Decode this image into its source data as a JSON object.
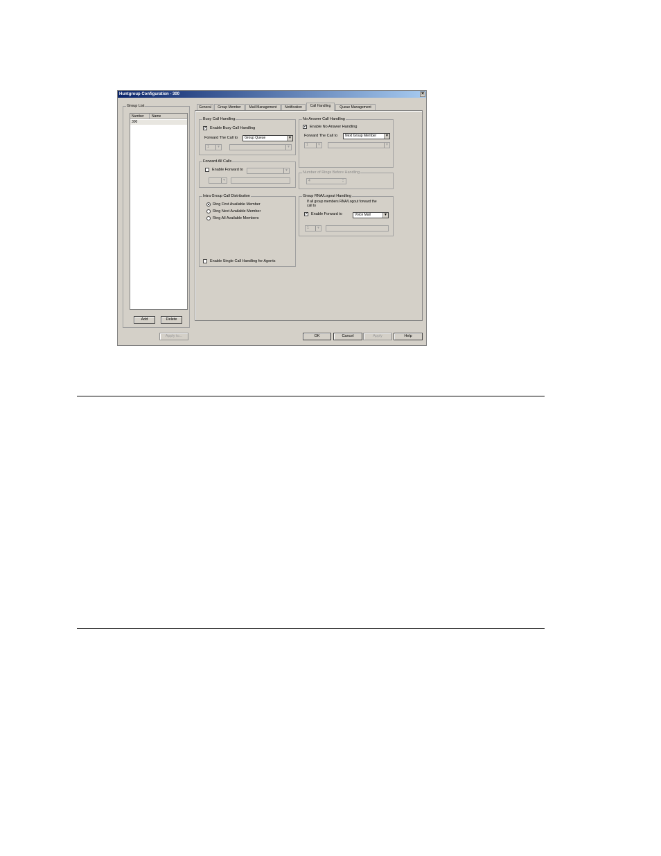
{
  "window": {
    "title": "Huntgroup Configuration - 300",
    "close_glyph": "×"
  },
  "group_list": {
    "title": "Group List",
    "columns": [
      "Number",
      "Name"
    ],
    "rows": [
      {
        "number": "300",
        "name": ""
      }
    ],
    "add_label": "Add",
    "delete_label": "Delete"
  },
  "tabs": [
    {
      "label": "General"
    },
    {
      "label": "Group Member"
    },
    {
      "label": "Mail Management"
    },
    {
      "label": "Notification"
    },
    {
      "label": "Call Handling",
      "active": true
    },
    {
      "label": "Queue Management"
    }
  ],
  "busy": {
    "title": "Busy Call Handling",
    "enable_label": "Enable Busy Call Handling",
    "enable_checked": true,
    "forward_label": "Forward The Call to",
    "forward_value": "Group Queue",
    "sub_value": "1"
  },
  "no_answer": {
    "title": "No Answer Call Handling",
    "enable_label": "Enable No Answer Handling",
    "enable_checked": true,
    "forward_label": "Forward The Call to",
    "forward_value": "Next Group Member",
    "sub_value": "1"
  },
  "forward_all": {
    "title": "Forward All Calls",
    "enable_label": "Enable Forward to",
    "enable_checked": false
  },
  "rings": {
    "title": "Number of Rings Before Handling",
    "value": "4"
  },
  "intra": {
    "title": "Intra Group Call Distribution",
    "options": [
      {
        "label": "Ring First Available Member",
        "selected": true
      },
      {
        "label": "Ring Next Available Member",
        "selected": false
      },
      {
        "label": "Ring All Available Members",
        "selected": false
      }
    ],
    "single_label": "Enable Single Call Handling for Agents",
    "single_checked": false
  },
  "rna": {
    "title": "Group RNA/Logout Handling",
    "desc_line1": "If all group members RNA/Logout forward the",
    "desc_line2": "call to",
    "enable_label": "Enable Forward to",
    "enable_checked": true,
    "forward_value": "Voice Mail",
    "sub_value": "1"
  },
  "buttons": {
    "apply_to": "Apply to...",
    "ok": "OK",
    "cancel": "Cancel",
    "apply": "Apply",
    "help": "Help"
  },
  "icons": {
    "check": "✓",
    "arrow_down": "▼",
    "spin_up": "▲",
    "spin_down": "▼"
  }
}
